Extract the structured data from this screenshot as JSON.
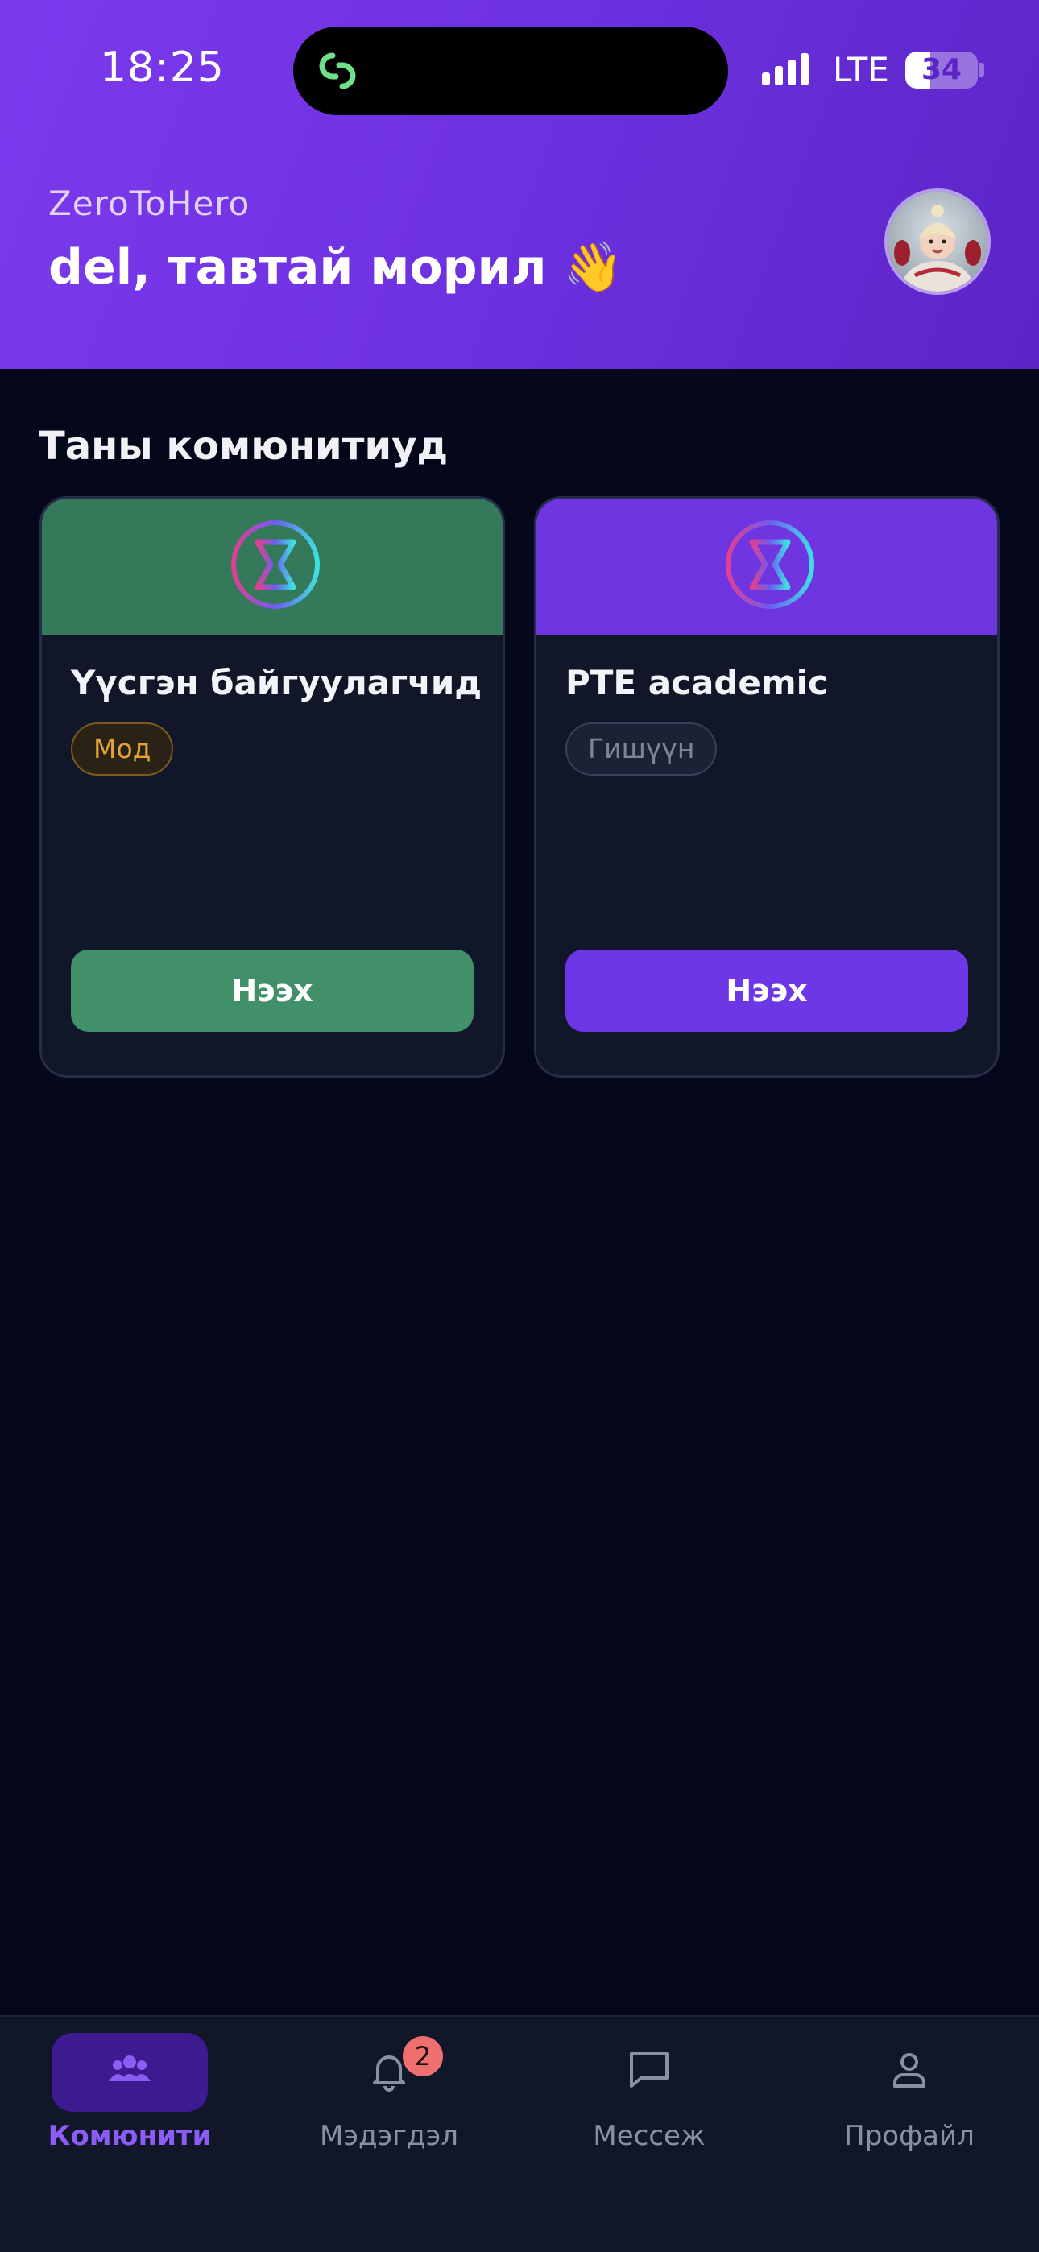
{
  "status_bar": {
    "time": "18:25",
    "network": "LTE",
    "battery": "34",
    "battery_level": 0.34
  },
  "header": {
    "app_name": "ZeroToHero",
    "greeting": "del, тавтай морил 👋"
  },
  "section_title": "Таны комюнитиуд",
  "communities": [
    {
      "name": "Үүсгэн байгуулагчид",
      "role": "Мод",
      "join_label": "Нээх",
      "banner_color": "#33795a",
      "button_color": "#41906a",
      "role_text_color": "#e3a33b"
    },
    {
      "name": "PTE academic",
      "role": "Гишүүн",
      "join_label": "Нээх",
      "banner_color": "#6e35e0",
      "button_color": "#6c38e6",
      "role_text_color": "#7f8498"
    }
  ],
  "nav": {
    "items": [
      {
        "label": "Комюнити",
        "icon": "people-icon",
        "active": true
      },
      {
        "label": "Мэдэгдэл",
        "icon": "bell-icon",
        "badge": "2"
      },
      {
        "label": "Мессеж",
        "icon": "chat-icon"
      },
      {
        "label": "Профайл",
        "icon": "user-icon"
      }
    ],
    "active_color": "#8b5cf6"
  }
}
